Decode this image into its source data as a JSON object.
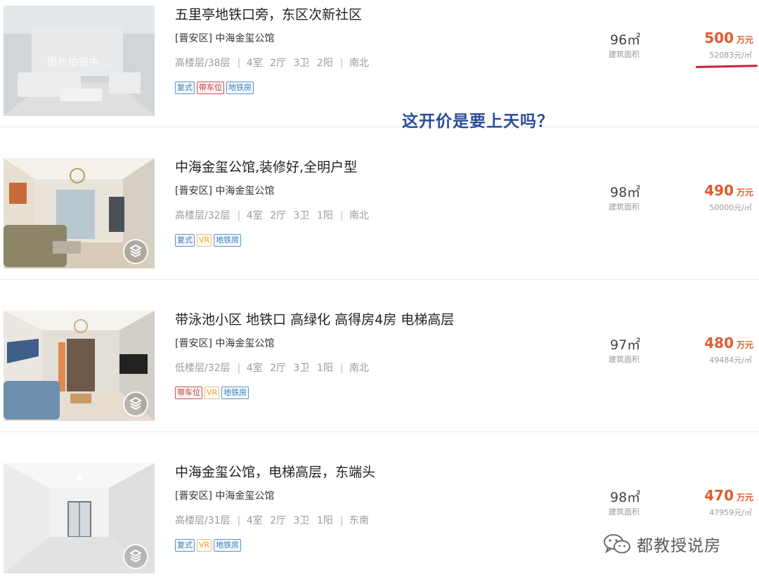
{
  "listings": [
    {
      "title": "五里亭地铁口旁，东区次新社区",
      "district": "[晋安区]",
      "community": "中海金玺公馆",
      "floor": "高楼层/38层",
      "rooms": "4室",
      "halls": "2厅",
      "baths": "3卫",
      "balconies": "2阳",
      "orientation": "南北",
      "tags": [
        "复式",
        "带车位",
        "地铁房"
      ],
      "area": "96㎡",
      "area_label": "建筑面积",
      "price": "500",
      "price_unit": "万元",
      "unit_price": "52083元/㎡",
      "thumb_overlay": "图片拍摄中..."
    },
    {
      "title": "中海金玺公馆,装修好,全明户型",
      "district": "[晋安区]",
      "community": "中海金玺公馆",
      "floor": "高楼层/32层",
      "rooms": "4室",
      "halls": "2厅",
      "baths": "3卫",
      "balconies": "1阳",
      "orientation": "南北",
      "tags": [
        "复式",
        "VR",
        "地铁房"
      ],
      "area": "98㎡",
      "area_label": "建筑面积",
      "price": "490",
      "price_unit": "万元",
      "unit_price": "50000元/㎡"
    },
    {
      "title": "带泳池小区 地铁口 高绿化 高得房4房 电梯高层",
      "district": "[晋安区]",
      "community": "中海金玺公馆",
      "floor": "低楼层/32层",
      "rooms": "4室",
      "halls": "2厅",
      "baths": "3卫",
      "balconies": "1阳",
      "orientation": "南北",
      "tags": [
        "带车位",
        "VR",
        "地铁房"
      ],
      "area": "97㎡",
      "area_label": "建筑面积",
      "price": "480",
      "price_unit": "万元",
      "unit_price": "49484元/㎡"
    },
    {
      "title": "中海金玺公馆，电梯高层，东端头",
      "district": "[晋安区]",
      "community": "中海金玺公馆",
      "floor": "高楼层/31层",
      "rooms": "4室",
      "halls": "2厅",
      "baths": "3卫",
      "balconies": "1阳",
      "orientation": "东南",
      "tags": [
        "复式",
        "VR",
        "地铁房"
      ],
      "area": "98㎡",
      "area_label": "建筑面积",
      "price": "470",
      "price_unit": "万元",
      "unit_price": "47959元/㎡"
    }
  ],
  "annotation": "这开价是要上天吗？",
  "watermark": "都教授说房",
  "colors": {
    "price": "#e25a2c",
    "annotation": "#2b4b9c",
    "underline": "#cc2233",
    "tag_blue": "#3f7fb5",
    "tag_red": "#c23b3b",
    "tag_orange": "#e8a241"
  },
  "icons": {
    "vr": "vr-panorama-icon",
    "watermark": "wechat-icon"
  }
}
